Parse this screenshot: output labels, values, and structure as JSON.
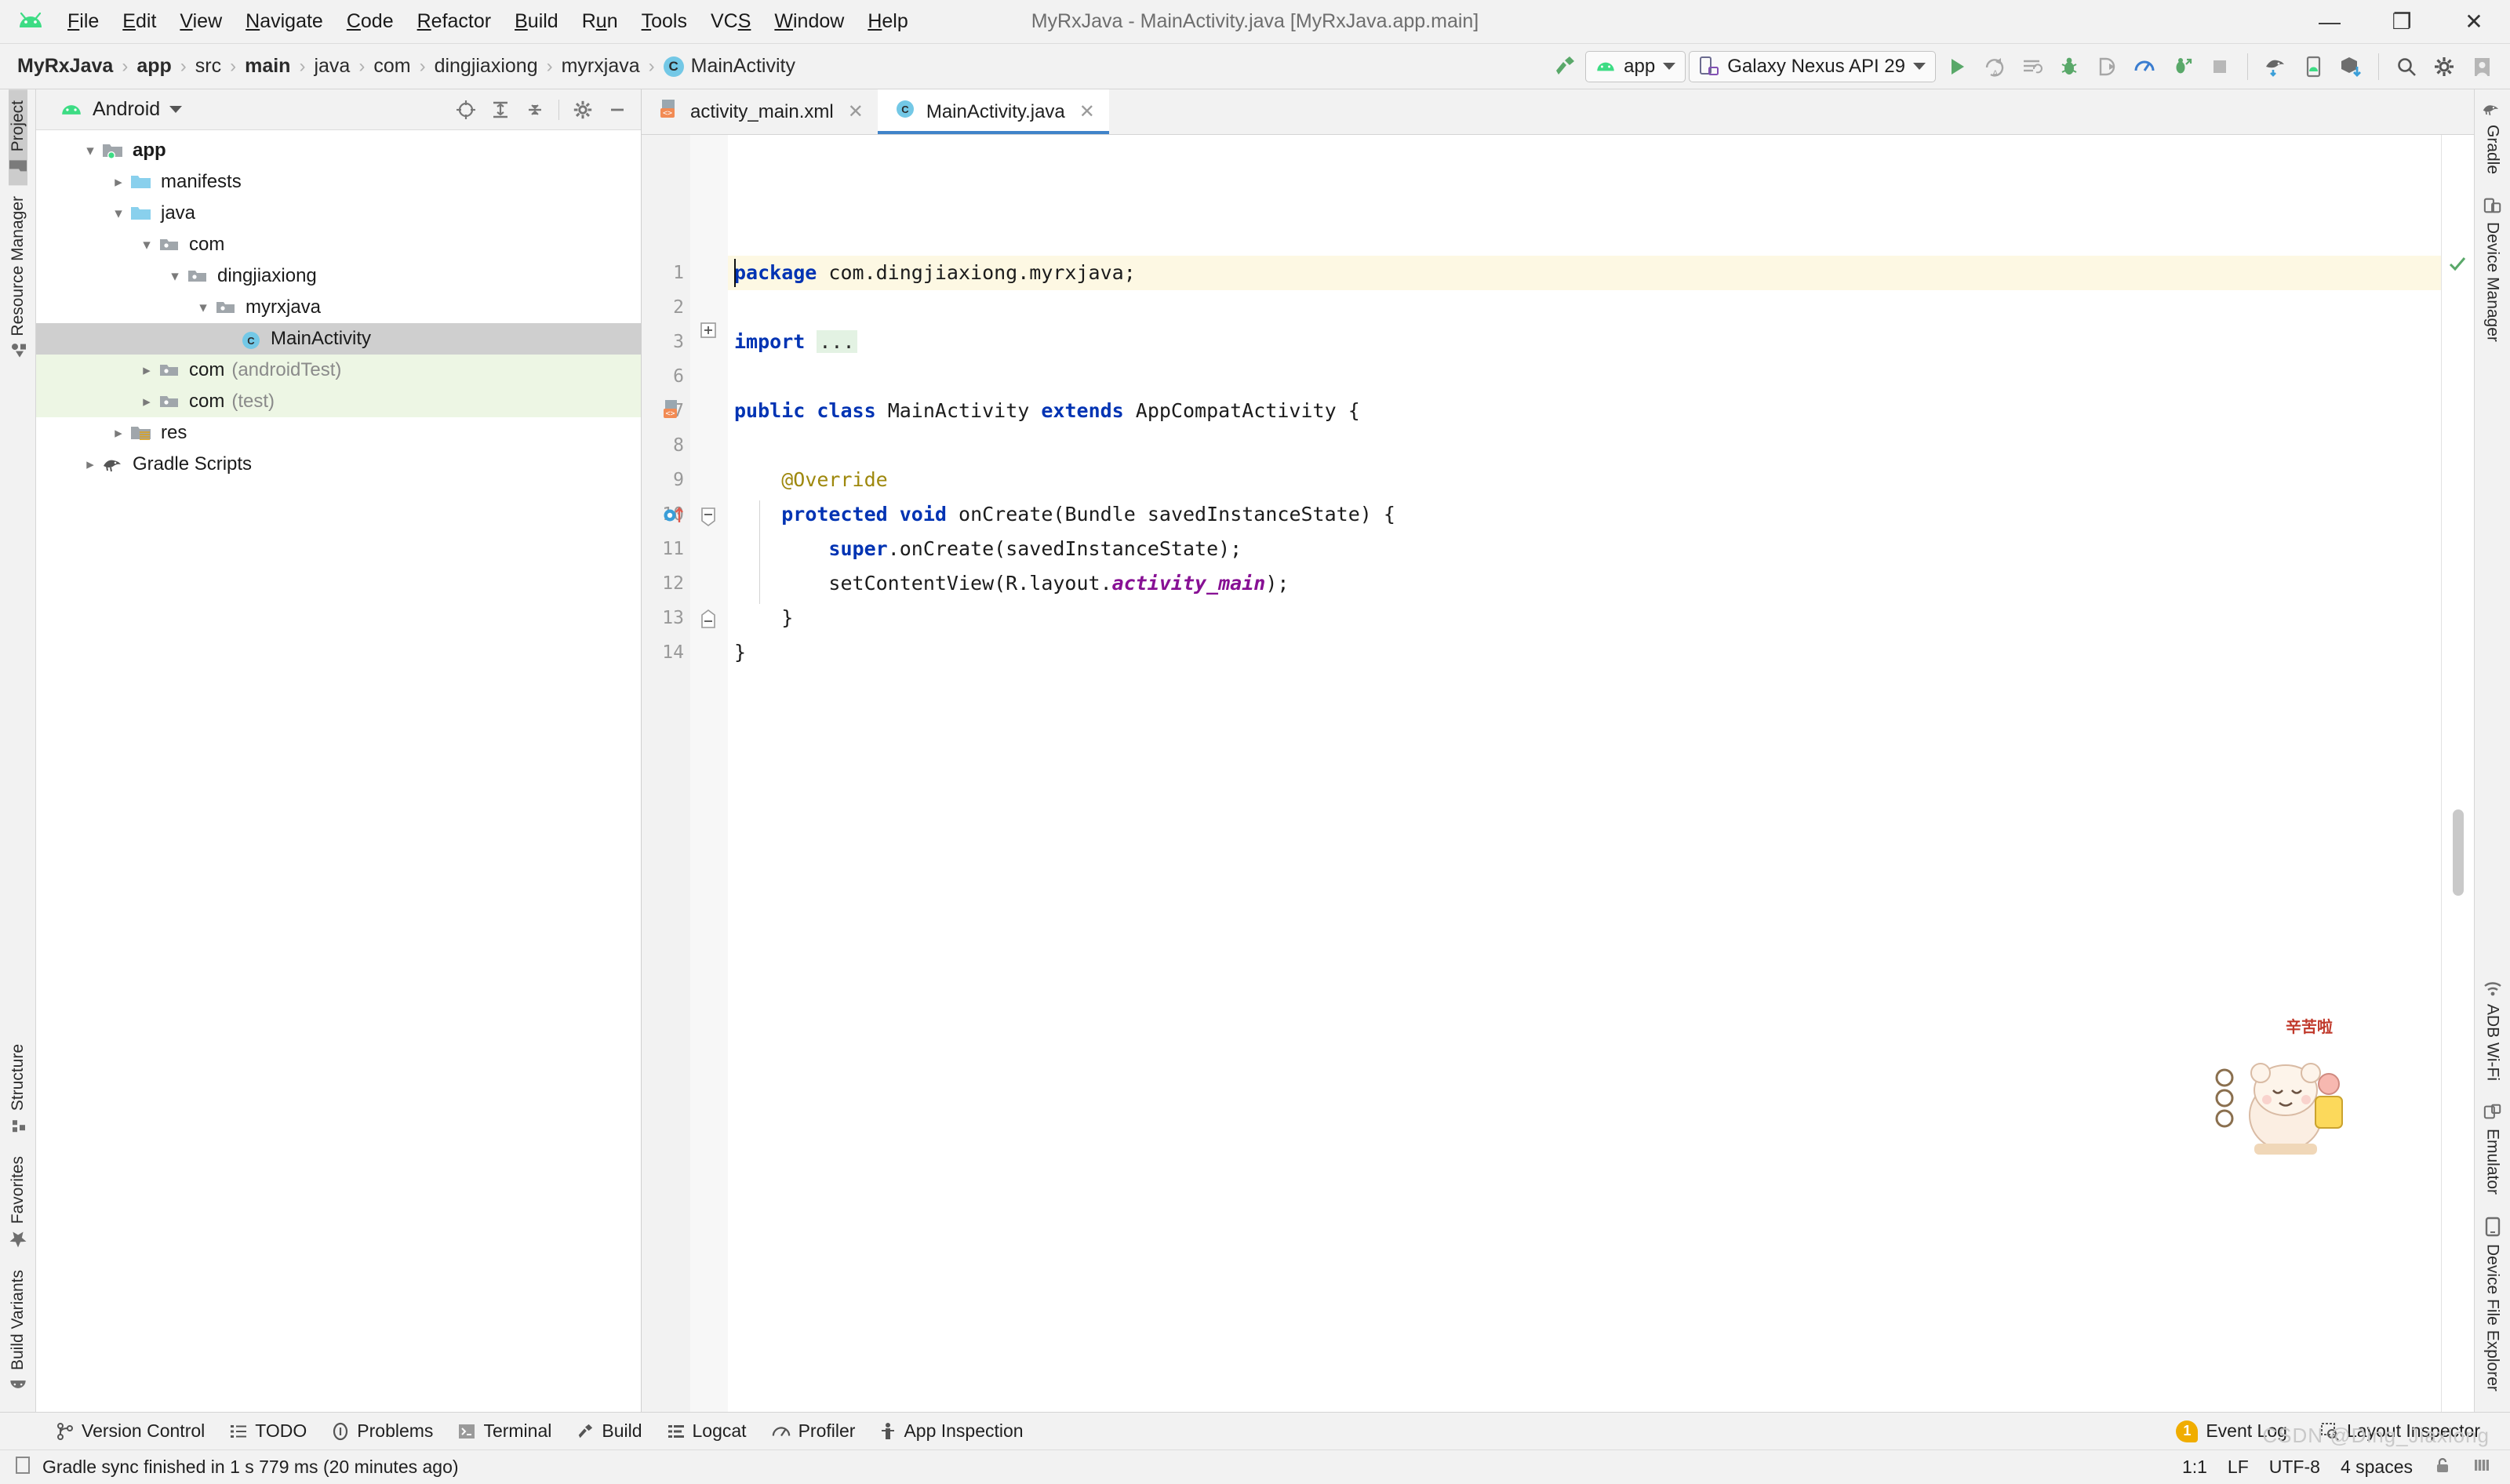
{
  "window": {
    "title": "MyRxJava - MainActivity.java [MyRxJava.app.main]",
    "minimize": "—",
    "maximize": "❐",
    "close": "✕"
  },
  "menubar": {
    "app_icon": "android-icon",
    "items": [
      {
        "label": "File",
        "mnemonic": "F"
      },
      {
        "label": "Edit",
        "mnemonic": "E"
      },
      {
        "label": "View",
        "mnemonic": "V"
      },
      {
        "label": "Navigate",
        "mnemonic": "N"
      },
      {
        "label": "Code",
        "mnemonic": "C"
      },
      {
        "label": "Refactor",
        "mnemonic": "R"
      },
      {
        "label": "Build",
        "mnemonic": "B"
      },
      {
        "label": "Run",
        "mnemonic": "u"
      },
      {
        "label": "Tools",
        "mnemonic": "T"
      },
      {
        "label": "VCS",
        "mnemonic": "S"
      },
      {
        "label": "Window",
        "mnemonic": "W"
      },
      {
        "label": "Help",
        "mnemonic": "H"
      }
    ]
  },
  "breadcrumb": {
    "separator": "›",
    "items": [
      {
        "label": "MyRxJava",
        "bold": true
      },
      {
        "label": "app",
        "bold": true
      },
      {
        "label": "src",
        "bold": false
      },
      {
        "label": "main",
        "bold": true
      },
      {
        "label": "java",
        "bold": false
      },
      {
        "label": "com",
        "bold": false
      },
      {
        "label": "dingjiaxiong",
        "bold": false
      },
      {
        "label": "myrxjava",
        "bold": false
      }
    ],
    "class_item": {
      "badge": "C",
      "label": "MainActivity"
    }
  },
  "toolbar": {
    "build_icon": "hammer-icon",
    "run_config": {
      "label": "app",
      "icon": "android-icon",
      "caret": "▼"
    },
    "device": {
      "label": "Galaxy Nexus API 29",
      "icon": "device-icon",
      "caret": "▼"
    },
    "actions": [
      {
        "name": "run-button",
        "icon": "play-icon"
      },
      {
        "name": "apply-changes-button",
        "icon": "apply-changes-icon"
      },
      {
        "name": "run-with-coverage-button",
        "icon": "coverage-icon"
      },
      {
        "name": "debug-button",
        "icon": "bug-icon"
      },
      {
        "name": "attach-debugger-button",
        "icon": "attach-debugger-icon"
      },
      {
        "name": "profile-button",
        "icon": "profiler-icon"
      },
      {
        "name": "debug-attach-icon",
        "icon": "debug-attach-icon"
      },
      {
        "name": "stop-button",
        "icon": "stop-icon"
      }
    ],
    "actions2": [
      {
        "name": "sync-gradle-button",
        "icon": "gradle-sync-icon"
      },
      {
        "name": "avd-manager-button",
        "icon": "avd-manager-icon"
      },
      {
        "name": "sdk-manager-button",
        "icon": "sdk-manager-icon"
      }
    ],
    "actions3": [
      {
        "name": "search-everywhere-button",
        "icon": "search-icon"
      },
      {
        "name": "settings-button",
        "icon": "gear-icon"
      },
      {
        "name": "account-button",
        "icon": "avatar-icon"
      }
    ]
  },
  "left_strip": {
    "top": [
      {
        "label": "Project",
        "icon": "folder-icon",
        "active": true
      },
      {
        "label": "Resource Manager",
        "icon": "resource-icon",
        "active": false
      }
    ],
    "bottom": [
      {
        "label": "Structure",
        "icon": "structure-icon"
      },
      {
        "label": "Favorites",
        "icon": "star-icon"
      },
      {
        "label": "Build Variants",
        "icon": "android-icon"
      }
    ]
  },
  "right_strip": {
    "top": [
      {
        "label": "Gradle",
        "icon": "gradle-elephant-icon"
      },
      {
        "label": "Device Manager",
        "icon": "device-manager-icon"
      }
    ],
    "bottom": [
      {
        "label": "ADB Wi-Fi",
        "icon": "wifi-icon"
      },
      {
        "label": "Emulator",
        "icon": "emulator-icon"
      },
      {
        "label": "Device File Explorer",
        "icon": "device-file-icon"
      }
    ]
  },
  "project_panel": {
    "title": "Android",
    "title_icon": "android-icon",
    "title_caret": "▼",
    "tools": [
      {
        "name": "select-opened-file-button",
        "icon": "target-icon"
      },
      {
        "name": "expand-all-button",
        "icon": "expand-all-icon"
      },
      {
        "name": "collapse-all-button",
        "icon": "collapse-all-icon"
      },
      {
        "name": "panel-settings-button",
        "icon": "gear-icon"
      },
      {
        "name": "hide-panel-button",
        "icon": "minimize-icon"
      }
    ],
    "tree": [
      {
        "label": "app",
        "depth": 0,
        "arrow": "down",
        "icon": "module-folder-icon",
        "bold": true,
        "state": "normal",
        "dim": ""
      },
      {
        "label": "manifests",
        "depth": 1,
        "arrow": "right",
        "icon": "blue-folder-icon",
        "bold": false,
        "state": "normal",
        "dim": ""
      },
      {
        "label": "java",
        "depth": 1,
        "arrow": "down",
        "icon": "blue-folder-icon",
        "bold": false,
        "state": "normal",
        "dim": ""
      },
      {
        "label": "com",
        "depth": 2,
        "arrow": "down",
        "icon": "package-icon",
        "bold": false,
        "state": "normal",
        "dim": ""
      },
      {
        "label": "dingjiaxiong",
        "depth": 3,
        "arrow": "down",
        "icon": "package-icon",
        "bold": false,
        "state": "normal",
        "dim": ""
      },
      {
        "label": "myrxjava",
        "depth": 4,
        "arrow": "down",
        "icon": "package-icon",
        "bold": false,
        "state": "normal",
        "dim": ""
      },
      {
        "label": "MainActivity",
        "depth": 5,
        "arrow": "none",
        "icon": "java-class-icon",
        "bold": false,
        "state": "selected",
        "dim": ""
      },
      {
        "label": "com",
        "depth": 2,
        "arrow": "right",
        "icon": "package-icon",
        "bold": false,
        "state": "testsrc",
        "dim": "(androidTest)"
      },
      {
        "label": "com",
        "depth": 2,
        "arrow": "right",
        "icon": "package-icon",
        "bold": false,
        "state": "testsrc",
        "dim": "(test)"
      },
      {
        "label": "res",
        "depth": 1,
        "arrow": "right",
        "icon": "res-folder-icon",
        "bold": false,
        "state": "normal",
        "dim": ""
      },
      {
        "label": "Gradle Scripts",
        "depth": 0,
        "arrow": "right",
        "icon": "gradle-elephant-icon",
        "bold": false,
        "state": "normal",
        "dim": ""
      }
    ]
  },
  "editor": {
    "tabs": [
      {
        "label": "activity_main.xml",
        "icon": "xml-layout-icon",
        "close": "✕",
        "active": false
      },
      {
        "label": "MainActivity.java",
        "icon": "java-class-icon",
        "close": "✕",
        "active": true
      }
    ],
    "inspection_status": "check-icon",
    "lines": [
      {
        "no": "1",
        "text": "package com.dingjiaxiong.myrxjava;"
      },
      {
        "no": "2",
        "text": ""
      },
      {
        "no": "3",
        "text": "import ..."
      },
      {
        "no": "6",
        "text": ""
      },
      {
        "no": "7",
        "text": "public class MainActivity extends AppCompatActivity {"
      },
      {
        "no": "8",
        "text": ""
      },
      {
        "no": "9",
        "text": "    @Override"
      },
      {
        "no": "10",
        "text": "    protected void onCreate(Bundle savedInstanceState) {"
      },
      {
        "no": "11",
        "text": "        super.onCreate(savedInstanceState);"
      },
      {
        "no": "12",
        "text": "        setContentView(R.layout.activity_main);"
      },
      {
        "no": "13",
        "text": "    }"
      },
      {
        "no": "14",
        "text": "}"
      }
    ]
  },
  "bottom_tools": [
    {
      "label": "Version Control",
      "icon": "branch-icon"
    },
    {
      "label": "TODO",
      "icon": "todo-icon"
    },
    {
      "label": "Problems",
      "icon": "problems-icon"
    },
    {
      "label": "Terminal",
      "icon": "terminal-icon"
    },
    {
      "label": "Build",
      "icon": "hammer-icon"
    },
    {
      "label": "Logcat",
      "icon": "logcat-icon"
    },
    {
      "label": "Profiler",
      "icon": "profiler-icon"
    },
    {
      "label": "App Inspection",
      "icon": "app-inspection-icon"
    }
  ],
  "bottom_right": {
    "event_log": {
      "label": "Event Log",
      "count": "1"
    },
    "layout_inspector": {
      "label": "Layout Inspector",
      "icon": "layout-inspector-icon"
    }
  },
  "statusbar": {
    "message": "Gradle sync finished in 1 s 779 ms (20 minutes ago)",
    "caret_position": "1:1",
    "line_separator": "LF",
    "encoding": "UTF-8",
    "indent": "4 spaces",
    "lock_icon": "lock-icon",
    "memory_icon": "memory-icon",
    "watermark": "CSDN @Ding_Jiaxiong"
  },
  "colors": {
    "accent_blue": "#4083c9",
    "android_green": "#3ddc84",
    "keyword_blue": "#0033b3",
    "field_purple": "#871094",
    "annotation_olive": "#9e880d",
    "selected_row": "#cfcfcf",
    "test_source_green": "#edf6e4",
    "current_line": "#fdf8e3",
    "event_badge": "#f0ad00"
  }
}
